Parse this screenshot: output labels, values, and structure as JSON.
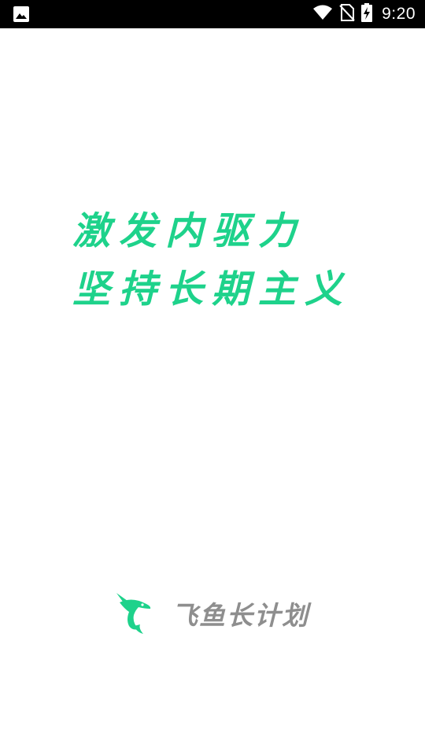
{
  "status_bar": {
    "time": "9:20",
    "icons": [
      "image-notification-icon",
      "wifi-icon",
      "no-sim-icon",
      "battery-charging-icon"
    ]
  },
  "splash": {
    "slogan_line1": "激发内驱力",
    "slogan_line2": "坚持长期主义",
    "brand_name": "飞鱼长计划",
    "logo_icon": "flying-fish-logo-icon"
  },
  "colors": {
    "accent": "#1ed28b",
    "brand_text": "#8e8e8e",
    "status_bar_bg": "#000000",
    "background": "#ffffff"
  }
}
